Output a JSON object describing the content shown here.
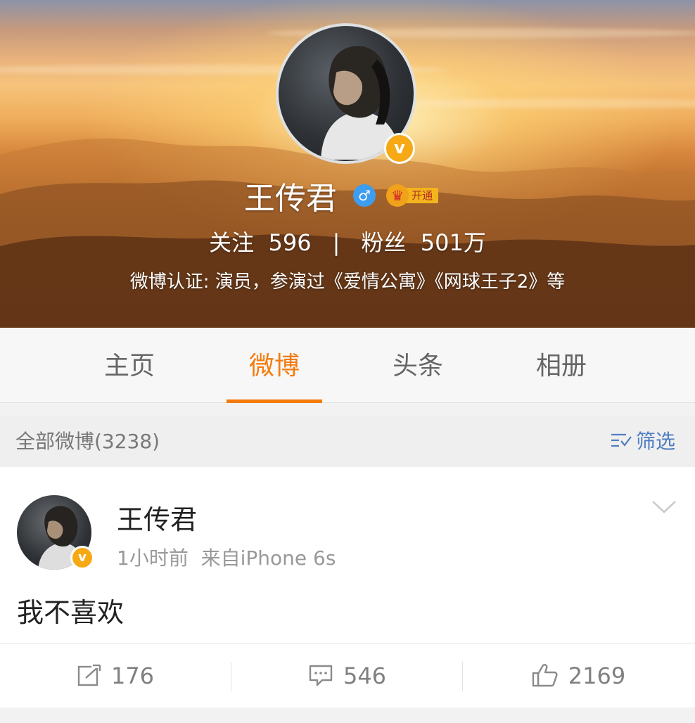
{
  "profile": {
    "name": "王传君",
    "gender_symbol": "♂",
    "vip_crown": "♛",
    "vip_label": "开通",
    "verified_badge": "v",
    "follow_label": "关注",
    "follow_count": "596",
    "separator": "|",
    "fans_label": "粉丝",
    "fans_count": "501万",
    "verification": "微博认证: 演员，参演过《爱情公寓》《网球王子2》等"
  },
  "tabs": [
    {
      "label": "主页"
    },
    {
      "label": "微博"
    },
    {
      "label": "头条"
    },
    {
      "label": "相册"
    }
  ],
  "active_tab": "微博",
  "filterbar": {
    "count_label": "全部微博(3238)",
    "filter_label": "筛选",
    "filter_icon": "filter-list-icon"
  },
  "post": {
    "author": "王传君",
    "time": "1小时前",
    "source": "来自iPhone 6s",
    "content": "我不喜欢",
    "verified_badge": "v",
    "reposts": "176",
    "comments": "546",
    "likes": "2169"
  },
  "colors": {
    "accent": "#f47c0d",
    "link": "#4f7ec2",
    "verified": "#f6a915",
    "gender": "#3d9df0"
  }
}
